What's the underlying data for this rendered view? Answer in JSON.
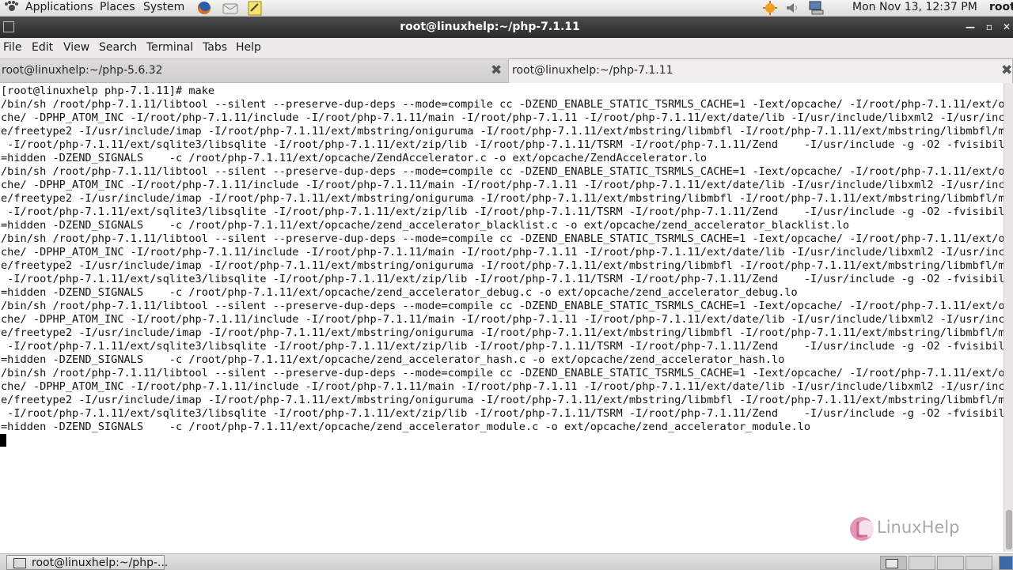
{
  "top_panel": {
    "menus": [
      "Applications",
      "Places",
      "System"
    ],
    "clock": "Mon Nov 13, 12:37 PM",
    "user": "root"
  },
  "window": {
    "title": "root@linuxhelp:~/php-7.1.11",
    "menu": [
      "File",
      "Edit",
      "View",
      "Search",
      "Terminal",
      "Tabs",
      "Help"
    ],
    "tabs": [
      {
        "label": "root@linuxhelp:~/php-5.6.32",
        "active": false
      },
      {
        "label": "root@linuxhelp:~/php-7.1.11",
        "active": true
      }
    ]
  },
  "terminal": {
    "lines": [
      "[root@linuxhelp php-7.1.11]# make",
      "/bin/sh /root/php-7.1.11/libtool --silent --preserve-dup-deps --mode=compile cc -DZEND_ENABLE_STATIC_TSRMLS_CACHE=1 -Iext/opcache/ -I/root/php-7.1.11/ext/opca",
      "che/ -DPHP_ATOM_INC -I/root/php-7.1.11/include -I/root/php-7.1.11/main -I/root/php-7.1.11 -I/root/php-7.1.11/ext/date/lib -I/usr/include/libxml2 -I/usr/includ",
      "e/freetype2 -I/usr/include/imap -I/root/php-7.1.11/ext/mbstring/oniguruma -I/root/php-7.1.11/ext/mbstring/libmbfl -I/root/php-7.1.11/ext/mbstring/libmbfl/mbfl",
      " -I/root/php-7.1.11/ext/sqlite3/libsqlite -I/root/php-7.1.11/ext/zip/lib -I/root/php-7.1.11/TSRM -I/root/php-7.1.11/Zend    -I/usr/include -g -O2 -fvisibility",
      "=hidden -DZEND_SIGNALS    -c /root/php-7.1.11/ext/opcache/ZendAccelerator.c -o ext/opcache/ZendAccelerator.lo",
      "/bin/sh /root/php-7.1.11/libtool --silent --preserve-dup-deps --mode=compile cc -DZEND_ENABLE_STATIC_TSRMLS_CACHE=1 -Iext/opcache/ -I/root/php-7.1.11/ext/opca",
      "che/ -DPHP_ATOM_INC -I/root/php-7.1.11/include -I/root/php-7.1.11/main -I/root/php-7.1.11 -I/root/php-7.1.11/ext/date/lib -I/usr/include/libxml2 -I/usr/includ",
      "e/freetype2 -I/usr/include/imap -I/root/php-7.1.11/ext/mbstring/oniguruma -I/root/php-7.1.11/ext/mbstring/libmbfl -I/root/php-7.1.11/ext/mbstring/libmbfl/mbfl",
      " -I/root/php-7.1.11/ext/sqlite3/libsqlite -I/root/php-7.1.11/ext/zip/lib -I/root/php-7.1.11/TSRM -I/root/php-7.1.11/Zend    -I/usr/include -g -O2 -fvisibility",
      "=hidden -DZEND_SIGNALS    -c /root/php-7.1.11/ext/opcache/zend_accelerator_blacklist.c -o ext/opcache/zend_accelerator_blacklist.lo",
      "/bin/sh /root/php-7.1.11/libtool --silent --preserve-dup-deps --mode=compile cc -DZEND_ENABLE_STATIC_TSRMLS_CACHE=1 -Iext/opcache/ -I/root/php-7.1.11/ext/opca",
      "che/ -DPHP_ATOM_INC -I/root/php-7.1.11/include -I/root/php-7.1.11/main -I/root/php-7.1.11 -I/root/php-7.1.11/ext/date/lib -I/usr/include/libxml2 -I/usr/includ",
      "e/freetype2 -I/usr/include/imap -I/root/php-7.1.11/ext/mbstring/oniguruma -I/root/php-7.1.11/ext/mbstring/libmbfl -I/root/php-7.1.11/ext/mbstring/libmbfl/mbfl",
      " -I/root/php-7.1.11/ext/sqlite3/libsqlite -I/root/php-7.1.11/ext/zip/lib -I/root/php-7.1.11/TSRM -I/root/php-7.1.11/Zend    -I/usr/include -g -O2 -fvisibility",
      "=hidden -DZEND_SIGNALS    -c /root/php-7.1.11/ext/opcache/zend_accelerator_debug.c -o ext/opcache/zend_accelerator_debug.lo",
      "/bin/sh /root/php-7.1.11/libtool --silent --preserve-dup-deps --mode=compile cc -DZEND_ENABLE_STATIC_TSRMLS_CACHE=1 -Iext/opcache/ -I/root/php-7.1.11/ext/opca",
      "che/ -DPHP_ATOM_INC -I/root/php-7.1.11/include -I/root/php-7.1.11/main -I/root/php-7.1.11 -I/root/php-7.1.11/ext/date/lib -I/usr/include/libxml2 -I/usr/includ",
      "e/freetype2 -I/usr/include/imap -I/root/php-7.1.11/ext/mbstring/oniguruma -I/root/php-7.1.11/ext/mbstring/libmbfl -I/root/php-7.1.11/ext/mbstring/libmbfl/mbfl",
      " -I/root/php-7.1.11/ext/sqlite3/libsqlite -I/root/php-7.1.11/ext/zip/lib -I/root/php-7.1.11/TSRM -I/root/php-7.1.11/Zend    -I/usr/include -g -O2 -fvisibility",
      "=hidden -DZEND_SIGNALS    -c /root/php-7.1.11/ext/opcache/zend_accelerator_hash.c -o ext/opcache/zend_accelerator_hash.lo",
      "/bin/sh /root/php-7.1.11/libtool --silent --preserve-dup-deps --mode=compile cc -DZEND_ENABLE_STATIC_TSRMLS_CACHE=1 -Iext/opcache/ -I/root/php-7.1.11/ext/opca",
      "che/ -DPHP_ATOM_INC -I/root/php-7.1.11/include -I/root/php-7.1.11/main -I/root/php-7.1.11 -I/root/php-7.1.11/ext/date/lib -I/usr/include/libxml2 -I/usr/includ",
      "e/freetype2 -I/usr/include/imap -I/root/php-7.1.11/ext/mbstring/oniguruma -I/root/php-7.1.11/ext/mbstring/libmbfl -I/root/php-7.1.11/ext/mbstring/libmbfl/mbfl",
      " -I/root/php-7.1.11/ext/sqlite3/libsqlite -I/root/php-7.1.11/ext/zip/lib -I/root/php-7.1.11/TSRM -I/root/php-7.1.11/Zend    -I/usr/include -g -O2 -fvisibility",
      "=hidden -DZEND_SIGNALS    -c /root/php-7.1.11/ext/opcache/zend_accelerator_module.c -o ext/opcache/zend_accelerator_module.lo"
    ]
  },
  "watermark": {
    "text": "LinuxHelp"
  },
  "bottom_panel": {
    "taskbar_label": "root@linuxhelp:~/php-..."
  },
  "icons": {
    "apps": "foot-logo-icon",
    "browser": "firefox-icon",
    "mail": "mail-icon",
    "editor": "text-editor-icon",
    "updates": "update-notifier-icon",
    "volume": "volume-icon",
    "network": "network-icon"
  },
  "colors": {
    "terminal_bg": "#ffffff",
    "terminal_fg": "#111111",
    "titlebar": "#333333",
    "watermark_primary": "#c9407a"
  }
}
